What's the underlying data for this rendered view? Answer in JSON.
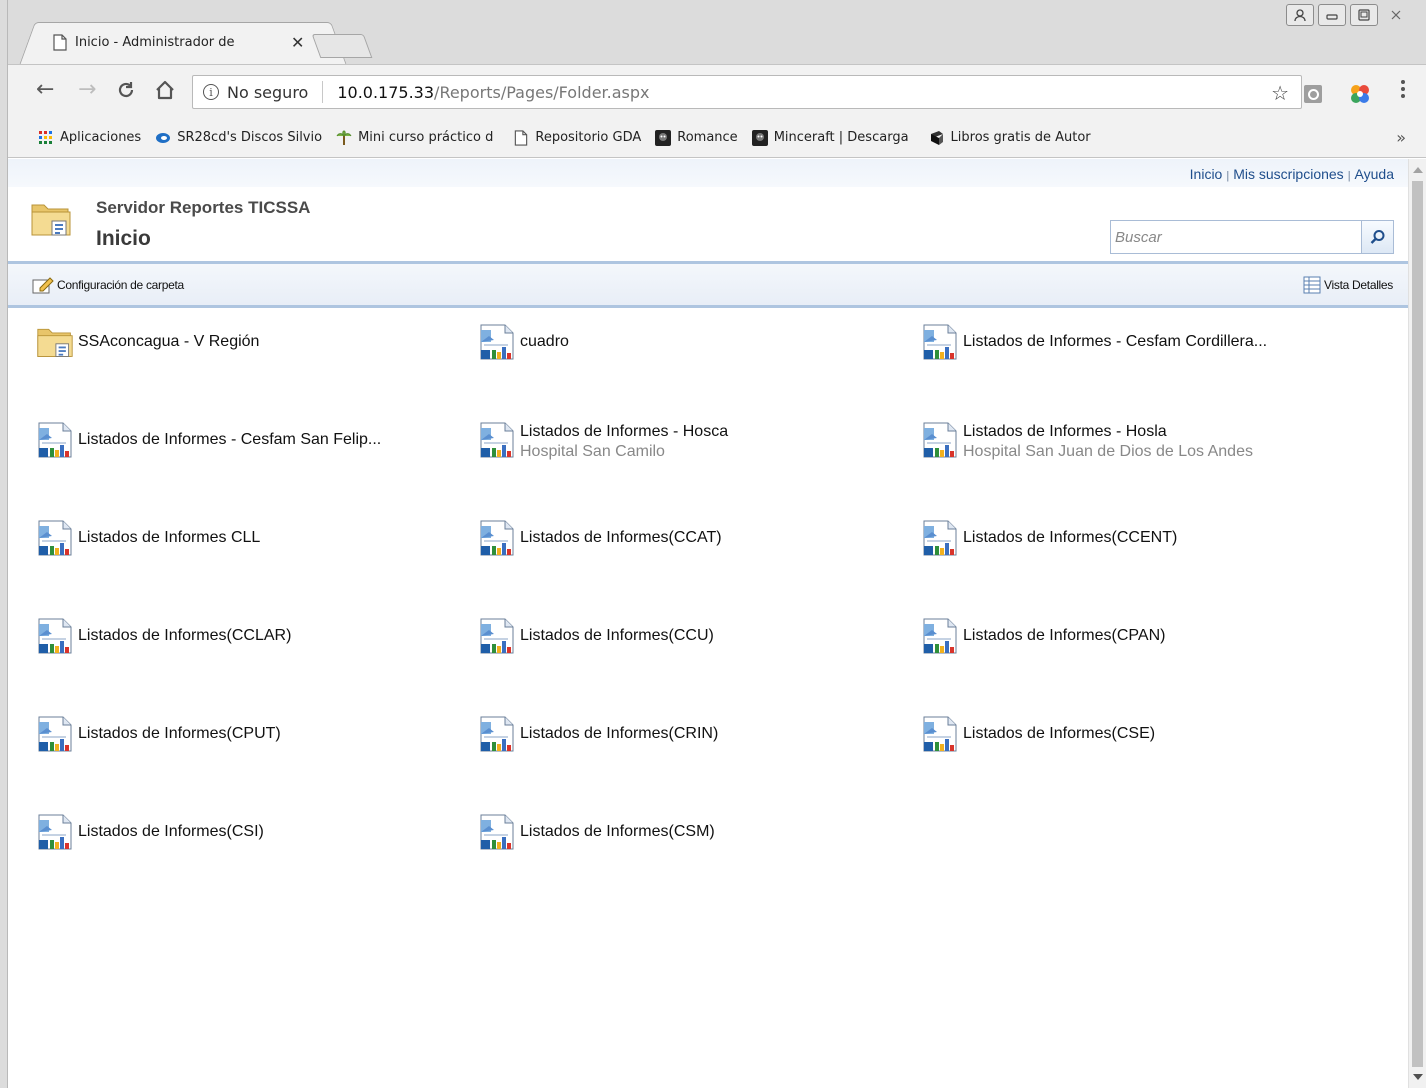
{
  "browser": {
    "tab_title": "Inicio - Administrador de",
    "tab_close": "✕",
    "nav": {
      "back": "←",
      "forward": "→",
      "reload": "C",
      "home": "⌂"
    },
    "security_label": "No seguro",
    "url_host": "10.0.175.33",
    "url_path": "/Reports/Pages/Folder.aspx",
    "star": "☆",
    "menu": "⋮",
    "window_buttons": {
      "user": "👤",
      "minimize": "▭",
      "restore": "❐",
      "close": "✕"
    },
    "bookmarks": [
      {
        "label": "Aplicaciones",
        "icon": "apps-grid-icon"
      },
      {
        "label": "SR28cd's Discos Silvio",
        "icon": "disc-icon"
      },
      {
        "label": "Mini curso práctico d",
        "icon": "palm-icon"
      },
      {
        "label": "Repositorio GDA",
        "icon": "document-icon"
      },
      {
        "label": "Romance",
        "icon": "dark-avatar-icon"
      },
      {
        "label": "Minceraft | Descarga",
        "icon": "dark-avatar-icon"
      },
      {
        "label": "Libros gratis de Autor",
        "icon": "book-icon"
      }
    ],
    "bookmarks_more": "»"
  },
  "page": {
    "topnav": {
      "home": "Inicio",
      "subscriptions": "Mis suscripciones",
      "help": "Ayuda",
      "separator": "|"
    },
    "server_name": "Servidor Reportes TICSSA",
    "title": "Inicio",
    "search_placeholder": "Buscar",
    "actions": {
      "folder_settings": "Configuración de carpeta",
      "details_view": "Vista Detalles"
    },
    "items": [
      {
        "name": "SSAconcagua - V Región",
        "description": "",
        "type": "folder"
      },
      {
        "name": "cuadro",
        "description": "",
        "type": "report"
      },
      {
        "name": "Listados de Informes - Cesfam Cordillera...",
        "description": "",
        "type": "report"
      },
      {
        "name": "Listados de Informes - Cesfam San Felip...",
        "description": "",
        "type": "report"
      },
      {
        "name": "Listados de Informes - Hosca",
        "description": "Hospital San Camilo",
        "type": "report"
      },
      {
        "name": "Listados de Informes - Hosla",
        "description": "Hospital San Juan de Dios de Los Andes",
        "type": "report"
      },
      {
        "name": "Listados de Informes CLL",
        "description": "",
        "type": "report"
      },
      {
        "name": "Listados de Informes(CCAT)",
        "description": "",
        "type": "report"
      },
      {
        "name": "Listados de Informes(CCENT)",
        "description": "",
        "type": "report"
      },
      {
        "name": "Listados de Informes(CCLAR)",
        "description": "",
        "type": "report"
      },
      {
        "name": "Listados de Informes(CCU)",
        "description": "",
        "type": "report"
      },
      {
        "name": "Listados de Informes(CPAN)",
        "description": "",
        "type": "report"
      },
      {
        "name": "Listados de Informes(CPUT)",
        "description": "",
        "type": "report"
      },
      {
        "name": "Listados de Informes(CRIN)",
        "description": "",
        "type": "report"
      },
      {
        "name": "Listados de Informes(CSE)",
        "description": "",
        "type": "report"
      },
      {
        "name": "Listados de Informes(CSI)",
        "description": "",
        "type": "report"
      },
      {
        "name": "Listados de Informes(CSM)",
        "description": "",
        "type": "report"
      }
    ]
  }
}
